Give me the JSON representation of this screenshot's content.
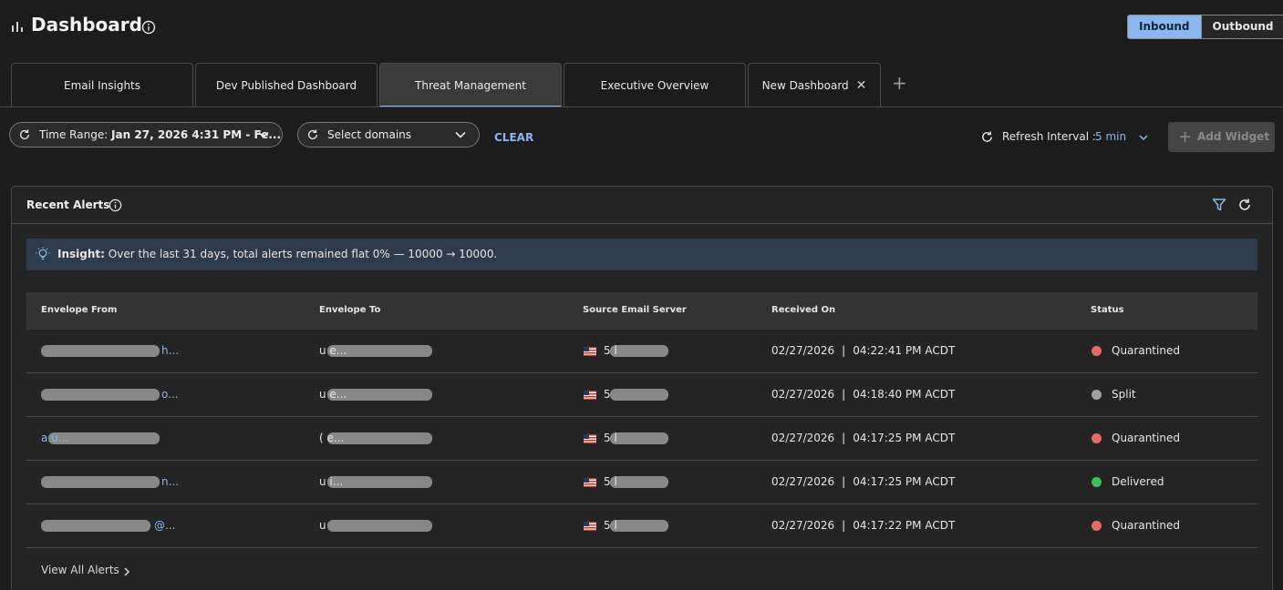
{
  "header": {
    "title": "Dashboard",
    "toggle": {
      "inbound": "Inbound",
      "outbound": "Outbound",
      "active": "Inbound"
    }
  },
  "tabs": [
    {
      "label": "Email Insights"
    },
    {
      "label": "Dev Published Dashboard"
    },
    {
      "label": "Threat Management",
      "active": true
    },
    {
      "label": "Executive Overview"
    },
    {
      "label": "New Dashboard",
      "closable": true
    }
  ],
  "filters": {
    "time_range_label": "Time Range:",
    "time_range_value": "Jan 27, 2026 4:31 PM - Fe...",
    "domains_placeholder": "Select domains",
    "clear_label": "CLEAR",
    "refresh_label": "Refresh Interval :",
    "refresh_value": "5 min",
    "add_widget_label": "Add Widget"
  },
  "widget": {
    "title": "Recent Alerts",
    "insight_label": "Insight:",
    "insight_text": "Over the last 31 days, total alerts remained flat 0% — 10000 → 10000.",
    "columns": [
      "Envelope From",
      "Envelope To",
      "Source Email Server",
      "Received On",
      "Status"
    ],
    "rows": [
      {
        "from": "h...",
        "to": "u e...",
        "server": "5 l",
        "date": "02/27/2026",
        "time": "04:22:41 PM ACDT",
        "status": "Quarantined",
        "status_color": "#e36b6b"
      },
      {
        "from": "o...",
        "to": "u e...",
        "server": "5",
        "date": "02/27/2026",
        "time": "04:18:40 PM ACDT",
        "status": "Split",
        "status_color": "#a0a0a0"
      },
      {
        "from": "a u...",
        "to": "( e...",
        "server": "5 l",
        "date": "02/27/2026",
        "time": "04:17:25 PM ACDT",
        "status": "Quarantined",
        "status_color": "#e36b6b"
      },
      {
        "from": "n...",
        "to": "u i...",
        "server": "5 l",
        "date": "02/27/2026",
        "time": "04:17:25 PM ACDT",
        "status": "Delivered",
        "status_color": "#3fbf5a"
      },
      {
        "from": "@...",
        "to": "u",
        "server": "5 l",
        "date": "02/27/2026",
        "time": "04:17:22 PM ACDT",
        "status": "Quarantined",
        "status_color": "#e36b6b"
      }
    ],
    "view_all_label": "View All Alerts"
  },
  "colors": {
    "accent": "#8ab8ee",
    "background": "#1c1c1c",
    "panel": "#242424"
  }
}
